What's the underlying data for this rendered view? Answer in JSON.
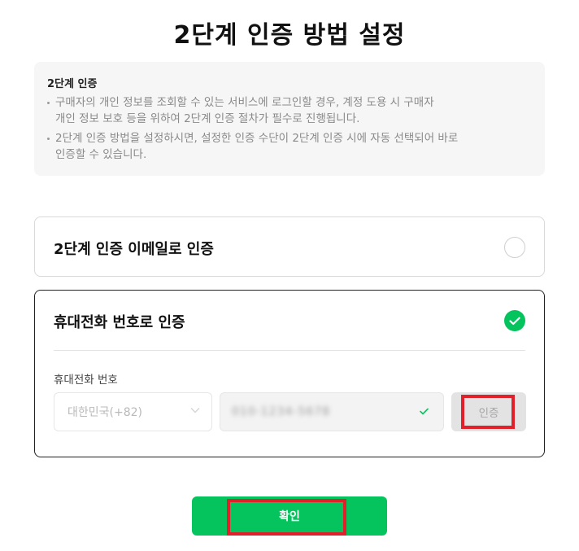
{
  "page": {
    "title": "2단계 인증 방법 설정"
  },
  "info": {
    "title": "2단계 인증",
    "items": [
      "구매자의 개인 정보를 조회할 수 있는 서비스에 로그인할 경우, 계정 도용 시 구매자\n개인 정보 보호 등을 위하여 2단계 인증 절차가 필수로 진행됩니다.",
      "2단계 인증 방법을 설정하시면, 설정한 인증 수단이 2단계 인증 시에 자동 선택되어 바로\n인증할 수 있습니다."
    ]
  },
  "options": {
    "email": {
      "label": "2단계 인증 이메일로 인증",
      "selected": false
    },
    "phone": {
      "label": "휴대전화 번호로 인증",
      "selected": true,
      "field_label": "휴대전화 번호",
      "country_value": "대한민국(+82)",
      "phone_value": "010-1234-5678",
      "verify_label": "인증"
    }
  },
  "confirm": {
    "label": "확인"
  },
  "colors": {
    "accent": "#05c35d",
    "highlight": "#e0202a"
  },
  "icons": {
    "radio_checked": "check-icon",
    "country_dropdown": "chevron-down-icon",
    "phone_valid": "check-icon"
  }
}
